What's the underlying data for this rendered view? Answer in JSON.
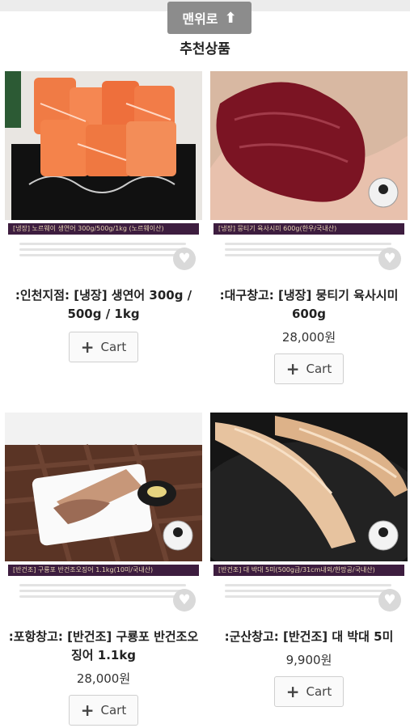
{
  "top_button": {
    "label": "맨위로",
    "icon": "arrow-up-icon"
  },
  "section_title": "추천상품",
  "products": [
    {
      "image_band": "[냉장] 노르웨이 생연어 300g/500g/1kg (노르웨이산)",
      "title": ":인천지점: [냉장] 생연어 300g / 500g / 1kg",
      "price": "",
      "cart_label": "Cart"
    },
    {
      "image_band": "[냉장] 뭉티기 육사시미 600g(한우/국내산)",
      "title": ":대구창고: [냉장] 뭉티기 육사시미 600g",
      "price": "28,000원",
      "cart_label": "Cart"
    },
    {
      "image_band": "[반건조] 구룡포 반건조오징어 1.1kg(10미/국내산)",
      "title": ":포항창고: [반건조] 구룡포 반건조오징어 1.1kg",
      "price": "28,000원",
      "cart_label": "Cart"
    },
    {
      "image_band": "[반건조] 대 박대 5미(500g급/31cm내외/한망공/국내산)",
      "title": ":군산창고: [반건조] 대 박대 5미",
      "price": "9,900원",
      "cart_label": "Cart"
    }
  ]
}
